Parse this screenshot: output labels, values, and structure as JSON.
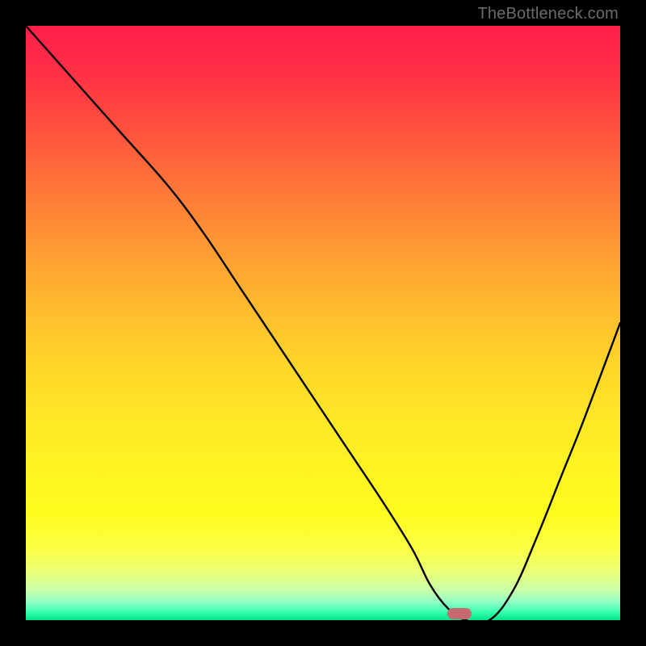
{
  "watermark": "TheBottleneck.com",
  "colors": {
    "frame": "#000000",
    "curve": "#000000",
    "marker": "#c76a6f",
    "gradient_top": "#ff1e4b",
    "gradient_bottom": "#00e68c"
  },
  "chart_data": {
    "type": "line",
    "title": "",
    "xlabel": "",
    "ylabel": "",
    "xlim": [
      0,
      100
    ],
    "ylim": [
      0,
      100
    ],
    "grid": false,
    "legend": false,
    "background": "vertical red→yellow→green gradient (bottleneck severity scale; green at bottom = no bottleneck)",
    "series": [
      {
        "name": "bottleneck-curve",
        "x": [
          0,
          8,
          16,
          24,
          30,
          36,
          42,
          48,
          54,
          60,
          65,
          68,
          71,
          74,
          78,
          82,
          86,
          90,
          94,
          100
        ],
        "values": [
          100,
          91,
          82,
          73,
          65,
          56,
          47,
          38,
          29,
          20,
          12,
          6,
          2,
          0,
          0,
          5,
          14,
          24,
          34,
          50
        ]
      }
    ],
    "annotations": [
      {
        "name": "optimal-marker",
        "x": 73,
        "y": 1,
        "shape": "rounded-rect",
        "color": "#c76a6f"
      }
    ]
  }
}
